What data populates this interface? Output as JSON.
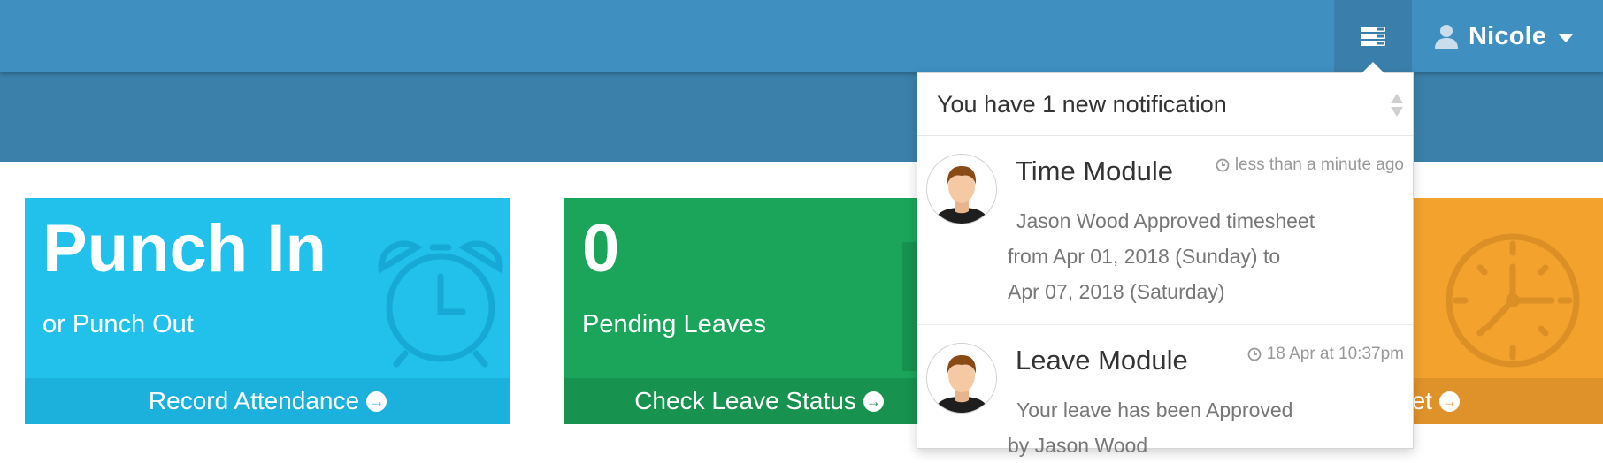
{
  "topbar": {
    "notifications_icon": "notification-list-icon",
    "user": {
      "icon": "user-icon",
      "name": "Nicole",
      "caret": "chevron-down-icon"
    }
  },
  "cards": {
    "punch": {
      "title": "Punch In",
      "subtitle": "or Punch Out",
      "footer": "Record Attendance",
      "color": "#22c1ec",
      "icon": "alarm-clock-icon"
    },
    "leaves": {
      "title": "0",
      "subtitle": "Pending Leaves",
      "footer": "Check Leave Status",
      "color": "#1ba55b"
    },
    "timesheet": {
      "footer": "eet",
      "color": "#f2a22d",
      "icon": "clock-icon"
    }
  },
  "notifications": {
    "header": "You have 1 new notification",
    "items": [
      {
        "module": "Time Module",
        "time": "less than a minute ago",
        "lines": [
          "Jason Wood Approved timesheet",
          "from Apr 01, 2018 (Sunday) to",
          "Apr 07, 2018 (Saturday)"
        ]
      },
      {
        "module": "Leave Module",
        "time": "18 Apr at 10:37pm",
        "lines": [
          "Your leave has been Approved",
          "by Jason Wood"
        ]
      }
    ]
  }
}
